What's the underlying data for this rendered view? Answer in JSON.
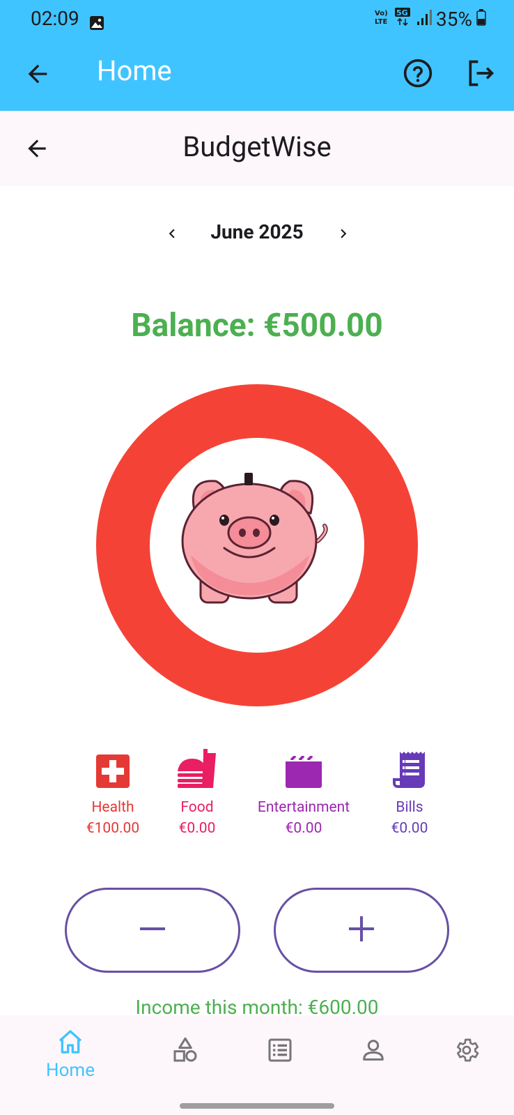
{
  "status_bar": {
    "time": "02:09",
    "network": "5G",
    "volte": "Vo)) LTE",
    "battery": "35%"
  },
  "app_bar": {
    "title": "Home"
  },
  "sub_bar": {
    "title": "BudgetWise"
  },
  "month": {
    "label": "June 2025"
  },
  "balance": {
    "text": "Balance: €500.00"
  },
  "categories": [
    {
      "name": "Health",
      "amount": "€100.00",
      "color": "#E53935",
      "icon": "medical-cross-icon"
    },
    {
      "name": "Food",
      "amount": "€0.00",
      "color": "#E91E63",
      "icon": "fastfood-icon"
    },
    {
      "name": "Entertainment",
      "amount": "€0.00",
      "color": "#9C27B0",
      "icon": "movie-clapper-icon"
    },
    {
      "name": "Bills",
      "amount": "€0.00",
      "color": "#673AB7",
      "icon": "receipt-icon"
    }
  ],
  "actions": {
    "minus": "−",
    "plus": "+"
  },
  "income": {
    "text": "Income this month: €600.00"
  },
  "bottom_nav": {
    "home_label": "Home"
  },
  "colors": {
    "accent": "#40C4FF",
    "balance": "#4CAF50",
    "donut": "#F44336",
    "button_border": "#6750A4"
  }
}
